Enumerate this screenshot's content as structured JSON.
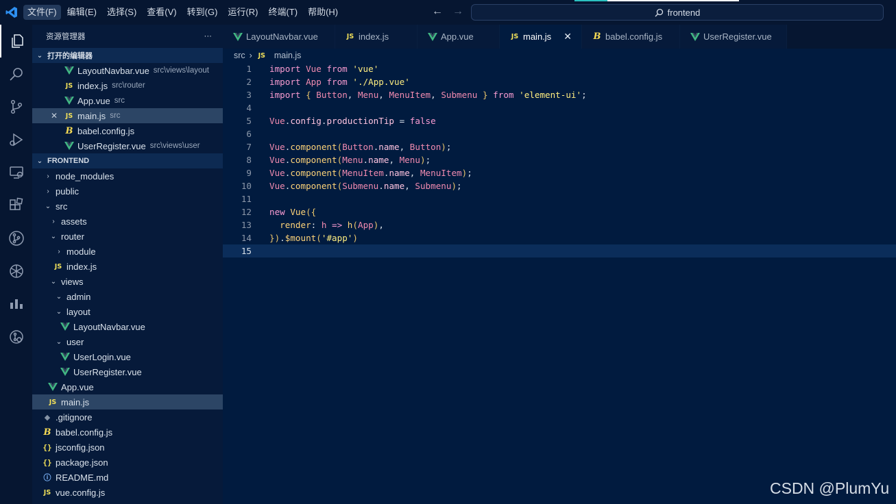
{
  "menubar": {
    "items": [
      "文件(F)",
      "编辑(E)",
      "选择(S)",
      "查看(V)",
      "转到(G)",
      "运行(R)",
      "终端(T)",
      "帮助(H)"
    ],
    "search_text": "frontend"
  },
  "activity_icons": [
    "explorer-icon",
    "search-icon",
    "source-control-icon",
    "run-debug-icon",
    "remote-explorer-icon",
    "extensions-icon",
    "gitlens-icon",
    "openai-icon",
    "charts-icon",
    "timeline-icon"
  ],
  "sidebar": {
    "title": "资源管理器",
    "more": "···",
    "open_editors_label": "打开的编辑器",
    "open_editors": [
      {
        "name": "LayoutNavbar.vue",
        "desc": "src\\views\\layout",
        "icon": "vue"
      },
      {
        "name": "index.js",
        "desc": "src\\router",
        "icon": "js"
      },
      {
        "name": "App.vue",
        "desc": "src",
        "icon": "vue"
      },
      {
        "name": "main.js",
        "desc": "src",
        "icon": "js"
      },
      {
        "name": "babel.config.js",
        "desc": "",
        "icon": "babel"
      },
      {
        "name": "UserRegister.vue",
        "desc": "src\\views\\user",
        "icon": "vue"
      }
    ],
    "project_label": "FRONTEND",
    "tree": [
      {
        "name": "node_modules"
      },
      {
        "name": "public"
      },
      {
        "name": "src"
      },
      {
        "name": "assets"
      },
      {
        "name": "router"
      },
      {
        "name": "module"
      },
      {
        "name": "index.js"
      },
      {
        "name": "views"
      },
      {
        "name": "admin"
      },
      {
        "name": "layout"
      },
      {
        "name": "LayoutNavbar.vue"
      },
      {
        "name": "user"
      },
      {
        "name": "UserLogin.vue"
      },
      {
        "name": "UserRegister.vue"
      },
      {
        "name": "App.vue"
      },
      {
        "name": "main.js"
      },
      {
        "name": ".gitignore"
      },
      {
        "name": "babel.config.js"
      },
      {
        "name": "jsconfig.json"
      },
      {
        "name": "package.json"
      },
      {
        "name": "README.md"
      },
      {
        "name": "vue.config.js"
      }
    ]
  },
  "tabs": [
    {
      "label": "LayoutNavbar.vue"
    },
    {
      "label": "index.js"
    },
    {
      "label": "App.vue"
    },
    {
      "label": "main.js",
      "close": "✕"
    },
    {
      "label": "babel.config.js"
    },
    {
      "label": "UserRegister.vue"
    }
  ],
  "breadcrumb": {
    "folder": "src",
    "file": "main.js"
  },
  "editor": {
    "line_numbers": [
      "1",
      "2",
      "3",
      "4",
      "5",
      "6",
      "7",
      "8",
      "9",
      "10",
      "11",
      "12",
      "13",
      "14",
      "15"
    ],
    "lines": [
      "import Vue from 'vue'",
      "import App from './App.vue'",
      "import { Button, Menu, MenuItem, Submenu } from 'element-ui';",
      "",
      "Vue.config.productionTip = false",
      "",
      "Vue.component(Button.name, Button);",
      "Vue.component(Menu.name, Menu);",
      "Vue.component(MenuItem.name, MenuItem);",
      "Vue.component(Submenu.name, Submenu);",
      "",
      "new Vue({",
      "  render: h => h(App),",
      "}).$mount('#app')",
      ""
    ]
  },
  "watermark": "CSDN @PlumYu"
}
